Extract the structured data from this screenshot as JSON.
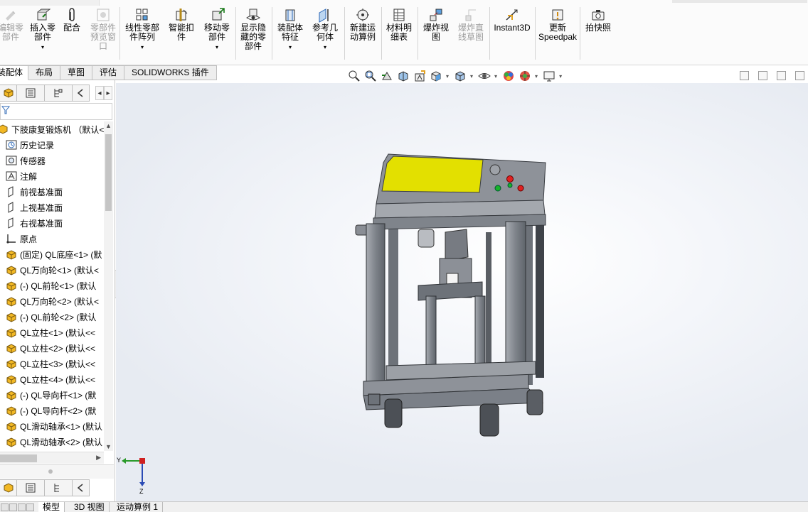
{
  "ribbon": {
    "buttons": [
      {
        "label": "编辑零\n部件",
        "disabled": true,
        "icon": "edit-component-icon"
      },
      {
        "label": "插入零\n部件",
        "disabled": false,
        "icon": "insert-component-icon",
        "dropdown": true
      },
      {
        "label": "配合",
        "disabled": false,
        "icon": "mate-paperclip-icon"
      },
      {
        "label": "零部件\n预览窗\n口",
        "disabled": true,
        "icon": "component-preview-icon"
      },
      {
        "label": "线性零部\n件阵列",
        "disabled": false,
        "icon": "linear-pattern-icon",
        "dropdown": true
      },
      {
        "label": "智能扣\n件",
        "disabled": false,
        "icon": "smart-fasteners-icon"
      },
      {
        "label": "移动零\n部件",
        "disabled": false,
        "icon": "move-component-icon",
        "dropdown": true
      },
      {
        "label": "显示隐\n藏的零\n部件",
        "disabled": false,
        "icon": "show-hidden-icon"
      },
      {
        "label": "装配体\n特征",
        "disabled": false,
        "icon": "assembly-features-icon",
        "dropdown": true
      },
      {
        "label": "参考几\n何体",
        "disabled": false,
        "icon": "reference-geometry-icon",
        "dropdown": true
      },
      {
        "label": "新建运\n动算例",
        "disabled": false,
        "icon": "new-motion-study-icon"
      },
      {
        "label": "材料明\n细表",
        "disabled": false,
        "icon": "bill-of-materials-icon"
      },
      {
        "label": "爆炸视\n图",
        "disabled": false,
        "icon": "exploded-view-icon"
      },
      {
        "label": "爆炸直\n线草图",
        "disabled": true,
        "icon": "explode-line-sketch-icon"
      },
      {
        "label": "Instant3D",
        "disabled": false,
        "icon": "instant3d-icon"
      },
      {
        "label": "更新\nSpeedpak",
        "disabled": false,
        "icon": "update-speedpak-icon"
      },
      {
        "label": "拍快照",
        "disabled": false,
        "icon": "snapshot-camera-icon"
      }
    ]
  },
  "tabs": [
    "装配体",
    "布局",
    "草图",
    "评估",
    "SOLIDWORKS 插件"
  ],
  "active_tab": 0,
  "view_toolbar": [
    "zoom-to-fit-icon",
    "zoom-to-area-icon",
    "previous-view-icon",
    "section-view-icon",
    "dynamic-annotation-icon",
    "view-orientation-icon",
    "display-style-icon",
    "hide-show-items-icon",
    "edit-appearance-icon",
    "apply-scene-icon",
    "view-settings-icon"
  ],
  "tree": {
    "root": "下肢康复锻炼机 （默认<默",
    "items": [
      {
        "label": "历史记录",
        "icon": "history-icon"
      },
      {
        "label": "传感器",
        "icon": "sensor-icon"
      },
      {
        "label": "注解",
        "icon": "annotation-icon"
      },
      {
        "label": "前视基准面",
        "icon": "plane-icon"
      },
      {
        "label": "上视基准面",
        "icon": "plane-icon"
      },
      {
        "label": "右视基准面",
        "icon": "plane-icon"
      },
      {
        "label": "原点",
        "icon": "origin-icon"
      },
      {
        "label": "(固定) QL底座<1> (默",
        "icon": "part-icon"
      },
      {
        "label": "QL万向轮<1> (默认<",
        "icon": "part-icon"
      },
      {
        "label": "(-) QL前轮<1> (默认",
        "icon": "part-icon"
      },
      {
        "label": "QL万向轮<2> (默认<",
        "icon": "part-icon"
      },
      {
        "label": "(-) QL前轮<2> (默认",
        "icon": "part-icon"
      },
      {
        "label": "QL立柱<1> (默认<<",
        "icon": "part-icon"
      },
      {
        "label": "QL立柱<2> (默认<<",
        "icon": "part-icon"
      },
      {
        "label": "QL立柱<3> (默认<<",
        "icon": "part-icon"
      },
      {
        "label": "QL立柱<4> (默认<<",
        "icon": "part-icon"
      },
      {
        "label": "(-) QL导向杆<1> (默",
        "icon": "part-icon"
      },
      {
        "label": "(-) QL导向杆<2> (默",
        "icon": "part-icon"
      },
      {
        "label": "QL滑动轴承<1> (默认",
        "icon": "part-icon"
      },
      {
        "label": "QL滑动轴承<2> (默认",
        "icon": "part-icon"
      }
    ]
  },
  "triad": {
    "y_label": "Y",
    "z_label": "Z"
  },
  "bottom_tabs": [
    "模型",
    "3D 视图",
    "运动算例 1"
  ],
  "active_bottom_tab": 0,
  "colors": {
    "frame": "#8e9299",
    "frame_dark": "#5f646b",
    "display_screen": "#e3e000",
    "button_red": "#e02020",
    "button_green": "#18b32a",
    "part_icon": "#f2b824"
  }
}
